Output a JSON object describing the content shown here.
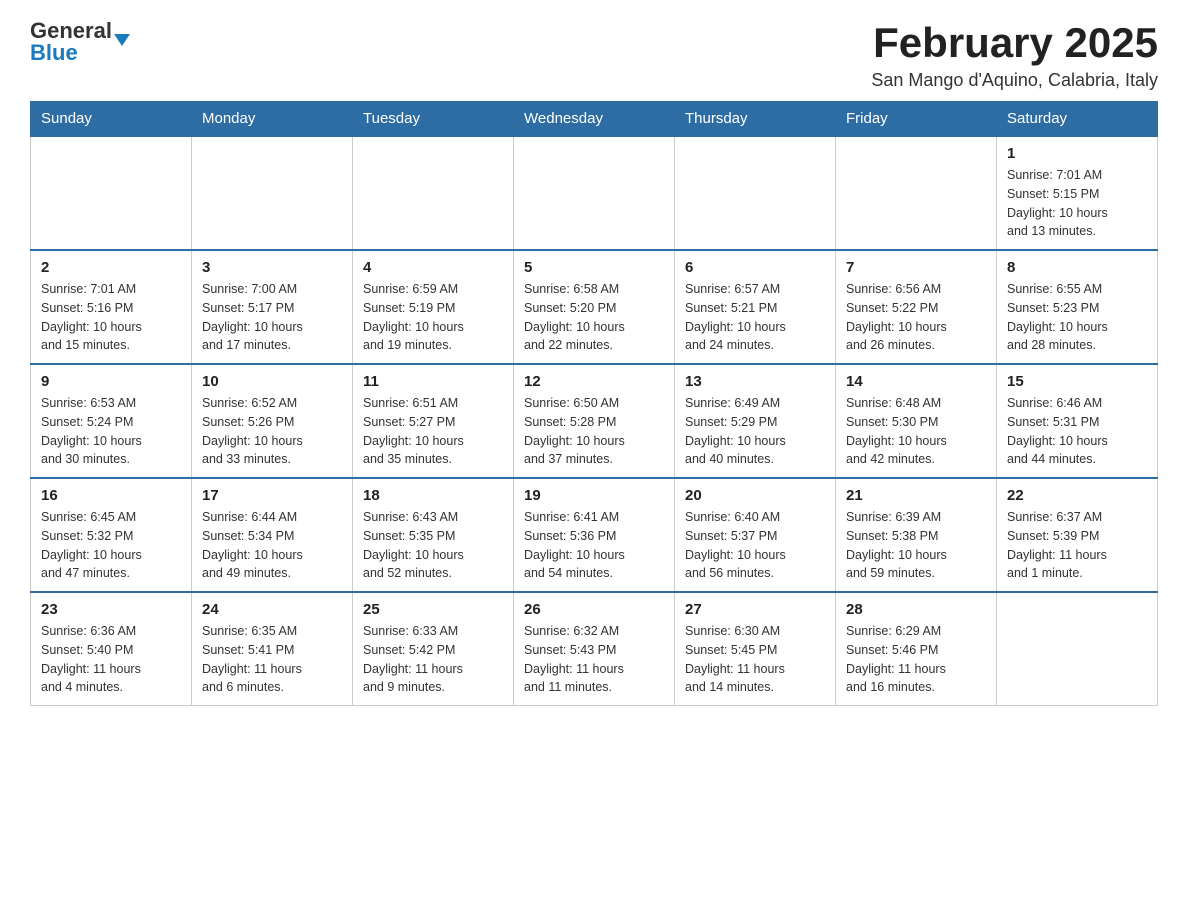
{
  "header": {
    "logo_general": "General",
    "logo_blue": "Blue",
    "month_title": "February 2025",
    "subtitle": "San Mango d'Aquino, Calabria, Italy"
  },
  "days_of_week": [
    "Sunday",
    "Monday",
    "Tuesday",
    "Wednesday",
    "Thursday",
    "Friday",
    "Saturday"
  ],
  "weeks": [
    {
      "days": [
        {
          "number": "",
          "info": ""
        },
        {
          "number": "",
          "info": ""
        },
        {
          "number": "",
          "info": ""
        },
        {
          "number": "",
          "info": ""
        },
        {
          "number": "",
          "info": ""
        },
        {
          "number": "",
          "info": ""
        },
        {
          "number": "1",
          "info": "Sunrise: 7:01 AM\nSunset: 5:15 PM\nDaylight: 10 hours\nand 13 minutes."
        }
      ]
    },
    {
      "days": [
        {
          "number": "2",
          "info": "Sunrise: 7:01 AM\nSunset: 5:16 PM\nDaylight: 10 hours\nand 15 minutes."
        },
        {
          "number": "3",
          "info": "Sunrise: 7:00 AM\nSunset: 5:17 PM\nDaylight: 10 hours\nand 17 minutes."
        },
        {
          "number": "4",
          "info": "Sunrise: 6:59 AM\nSunset: 5:19 PM\nDaylight: 10 hours\nand 19 minutes."
        },
        {
          "number": "5",
          "info": "Sunrise: 6:58 AM\nSunset: 5:20 PM\nDaylight: 10 hours\nand 22 minutes."
        },
        {
          "number": "6",
          "info": "Sunrise: 6:57 AM\nSunset: 5:21 PM\nDaylight: 10 hours\nand 24 minutes."
        },
        {
          "number": "7",
          "info": "Sunrise: 6:56 AM\nSunset: 5:22 PM\nDaylight: 10 hours\nand 26 minutes."
        },
        {
          "number": "8",
          "info": "Sunrise: 6:55 AM\nSunset: 5:23 PM\nDaylight: 10 hours\nand 28 minutes."
        }
      ]
    },
    {
      "days": [
        {
          "number": "9",
          "info": "Sunrise: 6:53 AM\nSunset: 5:24 PM\nDaylight: 10 hours\nand 30 minutes."
        },
        {
          "number": "10",
          "info": "Sunrise: 6:52 AM\nSunset: 5:26 PM\nDaylight: 10 hours\nand 33 minutes."
        },
        {
          "number": "11",
          "info": "Sunrise: 6:51 AM\nSunset: 5:27 PM\nDaylight: 10 hours\nand 35 minutes."
        },
        {
          "number": "12",
          "info": "Sunrise: 6:50 AM\nSunset: 5:28 PM\nDaylight: 10 hours\nand 37 minutes."
        },
        {
          "number": "13",
          "info": "Sunrise: 6:49 AM\nSunset: 5:29 PM\nDaylight: 10 hours\nand 40 minutes."
        },
        {
          "number": "14",
          "info": "Sunrise: 6:48 AM\nSunset: 5:30 PM\nDaylight: 10 hours\nand 42 minutes."
        },
        {
          "number": "15",
          "info": "Sunrise: 6:46 AM\nSunset: 5:31 PM\nDaylight: 10 hours\nand 44 minutes."
        }
      ]
    },
    {
      "days": [
        {
          "number": "16",
          "info": "Sunrise: 6:45 AM\nSunset: 5:32 PM\nDaylight: 10 hours\nand 47 minutes."
        },
        {
          "number": "17",
          "info": "Sunrise: 6:44 AM\nSunset: 5:34 PM\nDaylight: 10 hours\nand 49 minutes."
        },
        {
          "number": "18",
          "info": "Sunrise: 6:43 AM\nSunset: 5:35 PM\nDaylight: 10 hours\nand 52 minutes."
        },
        {
          "number": "19",
          "info": "Sunrise: 6:41 AM\nSunset: 5:36 PM\nDaylight: 10 hours\nand 54 minutes."
        },
        {
          "number": "20",
          "info": "Sunrise: 6:40 AM\nSunset: 5:37 PM\nDaylight: 10 hours\nand 56 minutes."
        },
        {
          "number": "21",
          "info": "Sunrise: 6:39 AM\nSunset: 5:38 PM\nDaylight: 10 hours\nand 59 minutes."
        },
        {
          "number": "22",
          "info": "Sunrise: 6:37 AM\nSunset: 5:39 PM\nDaylight: 11 hours\nand 1 minute."
        }
      ]
    },
    {
      "days": [
        {
          "number": "23",
          "info": "Sunrise: 6:36 AM\nSunset: 5:40 PM\nDaylight: 11 hours\nand 4 minutes."
        },
        {
          "number": "24",
          "info": "Sunrise: 6:35 AM\nSunset: 5:41 PM\nDaylight: 11 hours\nand 6 minutes."
        },
        {
          "number": "25",
          "info": "Sunrise: 6:33 AM\nSunset: 5:42 PM\nDaylight: 11 hours\nand 9 minutes."
        },
        {
          "number": "26",
          "info": "Sunrise: 6:32 AM\nSunset: 5:43 PM\nDaylight: 11 hours\nand 11 minutes."
        },
        {
          "number": "27",
          "info": "Sunrise: 6:30 AM\nSunset: 5:45 PM\nDaylight: 11 hours\nand 14 minutes."
        },
        {
          "number": "28",
          "info": "Sunrise: 6:29 AM\nSunset: 5:46 PM\nDaylight: 11 hours\nand 16 minutes."
        },
        {
          "number": "",
          "info": ""
        }
      ]
    }
  ]
}
